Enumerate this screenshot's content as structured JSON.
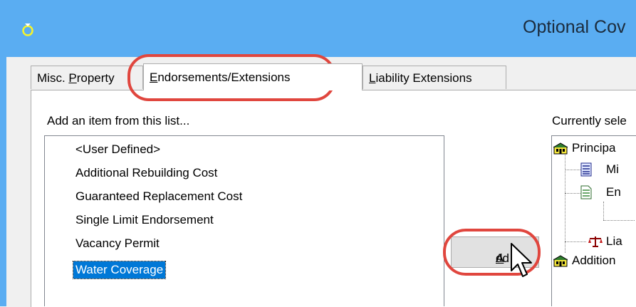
{
  "window": {
    "title": "Optional Cov"
  },
  "tabs": [
    {
      "label_pre": "Misc. ",
      "label_ul": "P",
      "label_post": "roperty"
    },
    {
      "label_pre": "",
      "label_ul": "E",
      "label_post": "ndorsements/Extensions"
    },
    {
      "label_pre": "",
      "label_ul": "L",
      "label_post": "iability Extensions"
    }
  ],
  "left_panel": {
    "label": "Add an item from this list...",
    "items": [
      "<User Defined>",
      "Additional Rebuilding Cost",
      "Guaranteed Replacement Cost",
      "Single Limit Endorsement",
      "Vacancy Permit",
      "Water Coverage"
    ],
    "selected": "Water Coverage"
  },
  "add_button": {
    "label_ul": "A",
    "label_post": "dd >>"
  },
  "right_panel": {
    "label": "Currently sele",
    "tree": [
      {
        "label": "Principa",
        "icon": "house-icon"
      },
      {
        "label": "Mi",
        "icon": "document-lines-icon"
      },
      {
        "label": "En",
        "icon": "document-green-icon"
      },
      {
        "label": "Lia",
        "icon": "scales-icon"
      },
      {
        "label": "Addition",
        "icon": "house-icon"
      }
    ]
  },
  "colors": {
    "titlebar": "#5aadf2",
    "selection": "#0078d7",
    "annotation": "#e0463e"
  }
}
